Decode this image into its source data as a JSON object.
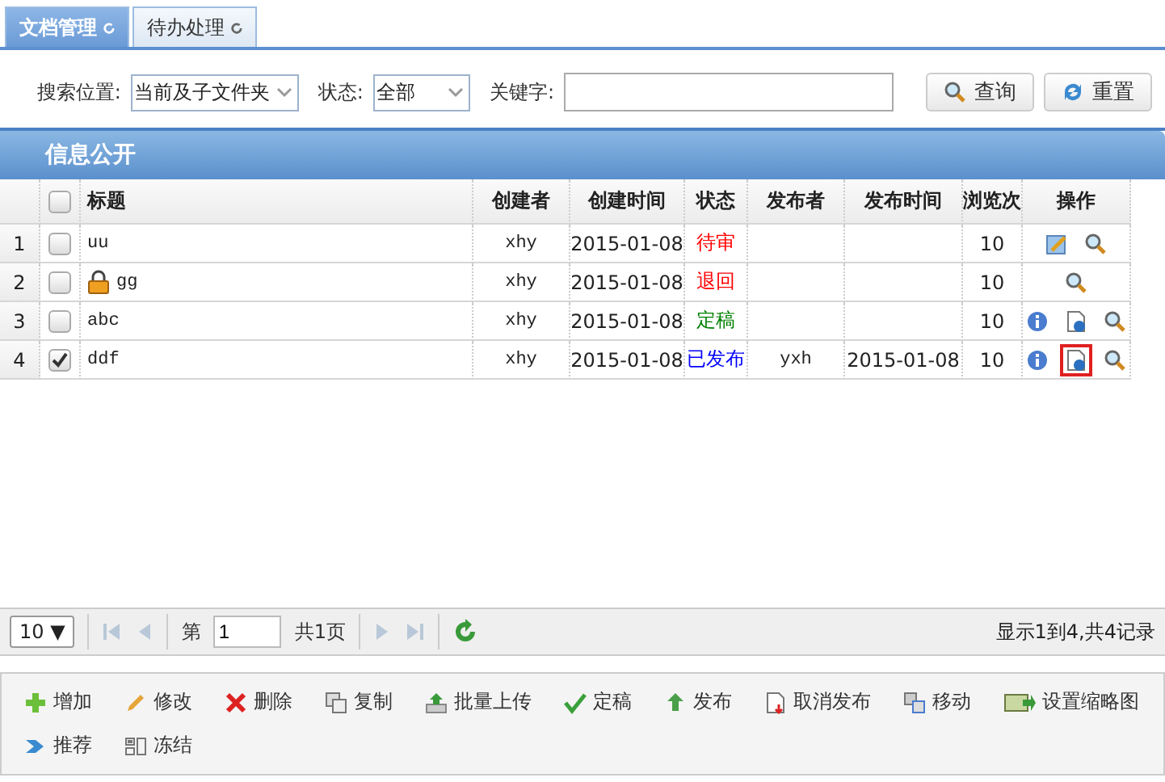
{
  "tabs": [
    {
      "label": "文档管理",
      "selected": true
    },
    {
      "label": "待办处理",
      "selected": false
    }
  ],
  "search": {
    "location_label": "搜索位置:",
    "location_value": "当前及子文件夹",
    "status_label": "状态:",
    "status_value": "全部",
    "keyword_label": "关键字:",
    "buttons": [
      {
        "kind": "search",
        "label": "查询"
      },
      {
        "kind": "reset",
        "label": "重置"
      }
    ]
  },
  "panel": {
    "title": "信息公开"
  },
  "table": {
    "all_checked": false,
    "columns": [
      "标题",
      "创建者",
      "创建时间",
      "状态",
      "发布者",
      "发布时间",
      "浏览次",
      "操作"
    ],
    "rows": [
      {
        "index": "1",
        "checked": false,
        "locked": false,
        "title": "uu",
        "creator": "xhy",
        "created": "2015-01-08",
        "status": "待审",
        "color": "#ff0000",
        "publisher": "",
        "published": "",
        "views": "10",
        "actions": [
          {
            "kind": "edit",
            "selected": false
          },
          {
            "kind": "view",
            "selected": false
          }
        ]
      },
      {
        "index": "2",
        "checked": false,
        "locked": true,
        "title": "gg",
        "creator": "xhy",
        "created": "2015-01-08",
        "status": "退回",
        "color": "#ff0000",
        "publisher": "",
        "published": "",
        "views": "10",
        "actions": [
          {
            "kind": "view",
            "selected": false
          }
        ]
      },
      {
        "index": "3",
        "checked": false,
        "locked": false,
        "title": "abc",
        "creator": "xhy",
        "created": "2015-01-08",
        "status": "定稿",
        "color": "#008000",
        "publisher": "",
        "published": "",
        "views": "10",
        "actions": [
          {
            "kind": "info",
            "selected": false
          },
          {
            "kind": "publish",
            "selected": false
          },
          {
            "kind": "view",
            "selected": false
          }
        ]
      },
      {
        "index": "4",
        "checked": true,
        "locked": false,
        "title": "ddf",
        "creator": "xhy",
        "created": "2015-01-08",
        "status": "已发布",
        "color": "#0000ff",
        "publisher": "yxh",
        "published": "2015-01-08",
        "views": "10",
        "actions": [
          {
            "kind": "info",
            "selected": false
          },
          {
            "kind": "publish",
            "selected": true
          },
          {
            "kind": "view",
            "selected": false
          }
        ]
      }
    ]
  },
  "pager": {
    "page_size": "10 ▼",
    "page_prefix": "第",
    "page_value": "1",
    "page_suffix": "共1页",
    "summary": "显示1到4,共4记录"
  },
  "toolbar": [
    {
      "kind": "add",
      "label": "增加"
    },
    {
      "kind": "edit",
      "label": "修改"
    },
    {
      "kind": "delete",
      "label": "删除"
    },
    {
      "kind": "copy",
      "label": "复制"
    },
    {
      "kind": "upload",
      "label": "批量上传"
    },
    {
      "kind": "finalize",
      "label": "定稿"
    },
    {
      "kind": "publish",
      "label": "发布"
    },
    {
      "kind": "unpublish",
      "label": "取消发布"
    },
    {
      "kind": "move",
      "label": "移动"
    },
    {
      "kind": "thumb",
      "label": "设置缩略图"
    },
    {
      "kind": "recommend",
      "label": "推荐"
    },
    {
      "kind": "freeze",
      "label": "冻结"
    }
  ]
}
